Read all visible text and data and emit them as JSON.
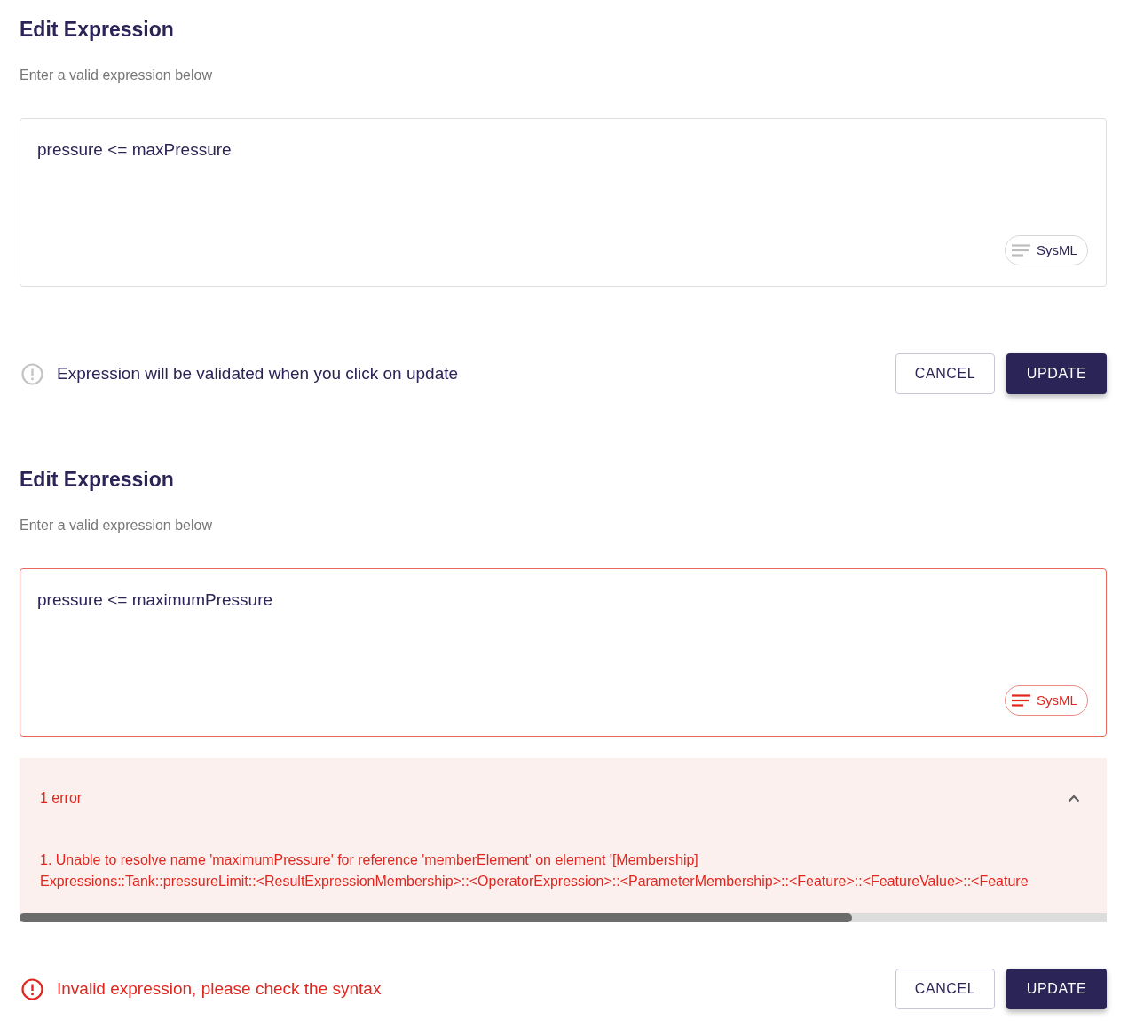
{
  "sections": [
    {
      "title": "Edit Expression",
      "subtitle": "Enter a valid expression below",
      "field": {
        "value": "pressure <= maxPressure",
        "invalid": false,
        "chip": "SysML"
      },
      "status": {
        "kind": "info",
        "text": "Expression will be validated when you click on update"
      },
      "buttons": [
        {
          "label": "CANCEL",
          "kind": "secondary"
        },
        {
          "label": "UPDATE",
          "kind": "primary"
        }
      ]
    },
    {
      "title": "Edit Expression",
      "subtitle": "Enter a valid expression below",
      "field": {
        "value": "pressure <= maximumPressure",
        "invalid": true,
        "chip": "SysML"
      },
      "error_panel": {
        "summary": "1 error",
        "expanded": true,
        "messages": [
          "1. Unable to resolve name 'maximumPressure' for reference 'memberElement' on element '[Membership]\nExpressions::Tank::pressureLimit::<ResultExpressionMembership>::<OperatorExpression>::<ParameterMembership>::<Feature>::<FeatureValue>::<Feature"
        ]
      },
      "status": {
        "kind": "error",
        "text": "Invalid expression, please check the syntax"
      },
      "buttons": [
        {
          "label": "CANCEL",
          "kind": "secondary"
        },
        {
          "label": "UPDATE",
          "kind": "primary"
        }
      ]
    }
  ]
}
